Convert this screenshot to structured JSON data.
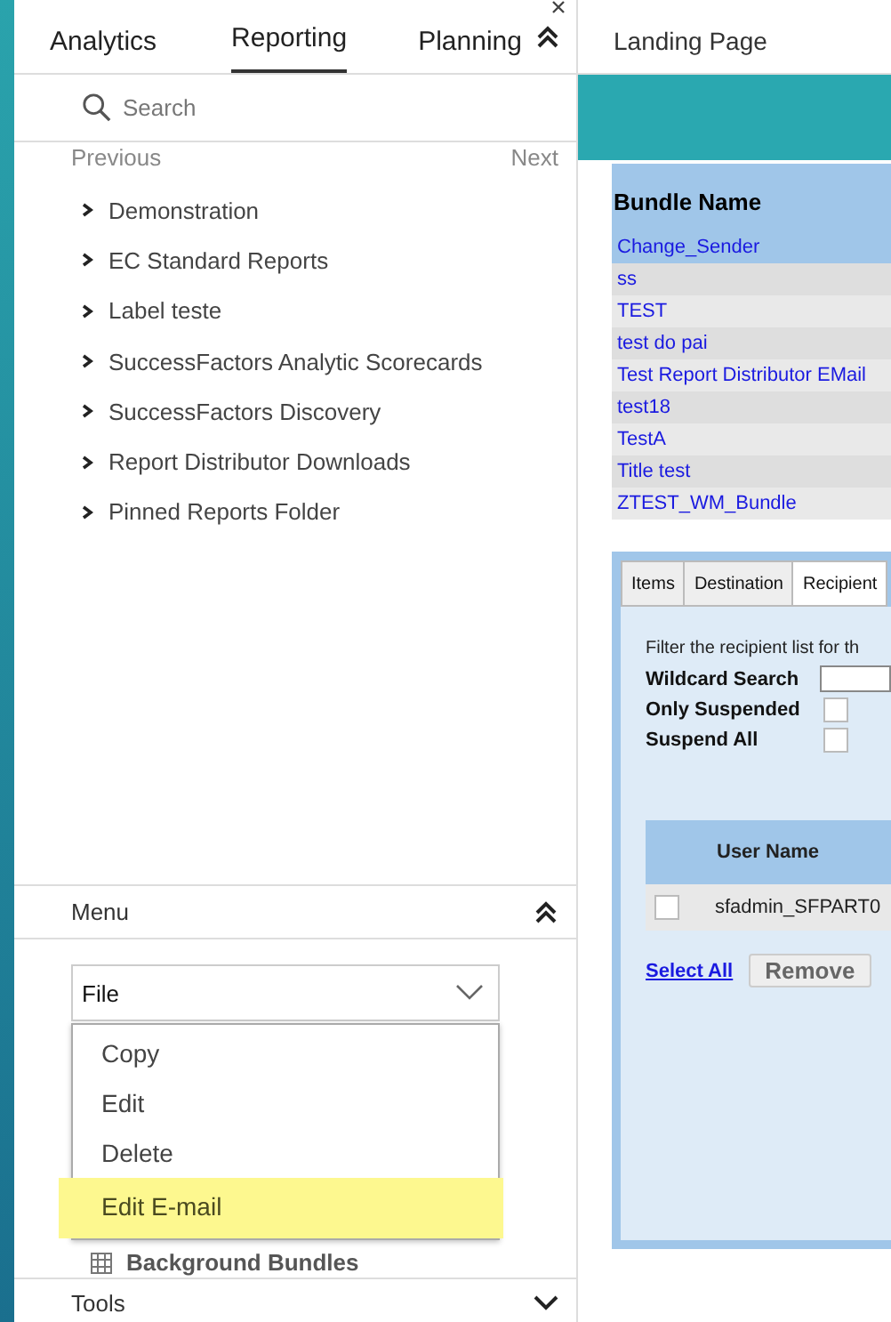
{
  "left_panel": {
    "tabs": [
      {
        "label": "Analytics",
        "selected": false
      },
      {
        "label": "Reporting",
        "selected": true
      },
      {
        "label": "Planning",
        "selected": false
      }
    ],
    "search": {
      "placeholder": "Search"
    },
    "pager": {
      "previous": "Previous",
      "next": "Next"
    },
    "tree": [
      {
        "label": "Demonstration",
        "expanded": false
      },
      {
        "label": "EC Standard Reports",
        "expanded": false
      },
      {
        "label": "Label teste",
        "expanded": false
      },
      {
        "label": "SuccessFactors Analytic Scorecards",
        "expanded": false
      },
      {
        "label": "SuccessFactors Discovery",
        "expanded": false
      },
      {
        "label": "Report Distributor Downloads",
        "expanded": false
      },
      {
        "label": "Pinned Reports Folder",
        "expanded": false
      }
    ],
    "menu": {
      "title": "Menu",
      "expanded": true,
      "dropdown": {
        "value": "File",
        "options": [
          {
            "label": "Copy",
            "highlighted": false
          },
          {
            "label": "Edit",
            "highlighted": false
          },
          {
            "label": "Delete",
            "highlighted": false
          },
          {
            "label": "Edit E-mail",
            "highlighted": true
          }
        ]
      },
      "items": [
        "Background Bundles"
      ]
    },
    "tools": {
      "title": "Tools",
      "expanded": false
    }
  },
  "main": {
    "title": "Landing Page",
    "bundles": {
      "column": "Bundle Name",
      "rows": [
        {
          "name": "Change_Sender",
          "selected": true
        },
        {
          "name": "ss",
          "selected": false
        },
        {
          "name": "TEST",
          "selected": false
        },
        {
          "name": "test do pai",
          "selected": false
        },
        {
          "name": "Test Report Distributor EMail",
          "selected": false
        },
        {
          "name": "test18",
          "selected": false
        },
        {
          "name": "TestA",
          "selected": false
        },
        {
          "name": "Title test",
          "selected": false
        },
        {
          "name": "ZTEST_WM_Bundle",
          "selected": false
        }
      ]
    },
    "detail": {
      "tabs": [
        {
          "label": "Items",
          "selected": false
        },
        {
          "label": "Destination",
          "selected": false
        },
        {
          "label": "Recipient",
          "selected": true
        }
      ],
      "filter_text": "Filter the recipient list for th",
      "wildcard_label": "Wildcard Search",
      "options": [
        {
          "label": "Only Suspended",
          "checked": false
        },
        {
          "label": "Suspend All",
          "checked": false
        }
      ],
      "recipients": {
        "column": "User Name",
        "rows": [
          {
            "name": "sfadmin_SFPART0",
            "checked": false
          }
        ]
      },
      "select_all": "Select All",
      "remove": "Remove"
    }
  }
}
